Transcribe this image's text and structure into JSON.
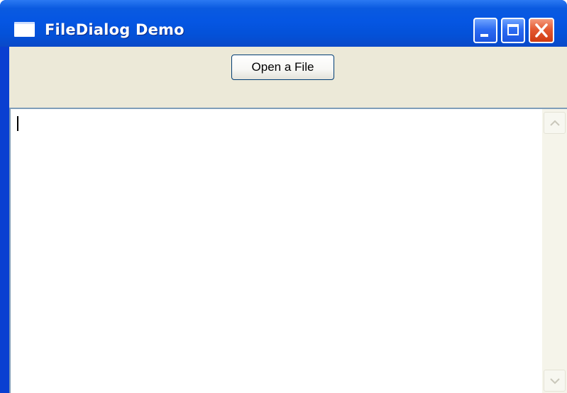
{
  "window": {
    "title": "FileDialog Demo",
    "icon": "window-icon",
    "controls": {
      "minimize_icon": "minimize-icon",
      "maximize_icon": "maximize-icon",
      "close_icon": "close-icon"
    }
  },
  "toolbar": {
    "open_label": "Open a File"
  },
  "content": {
    "text": "",
    "scrollbar": {
      "up_icon": "chevron-up-icon",
      "down_icon": "chevron-down-icon"
    }
  },
  "colors": {
    "titlebar": "#0556e3",
    "client": "#ece9d8",
    "close_button": "#e45a32",
    "text_area_border": "#7f9db9"
  }
}
